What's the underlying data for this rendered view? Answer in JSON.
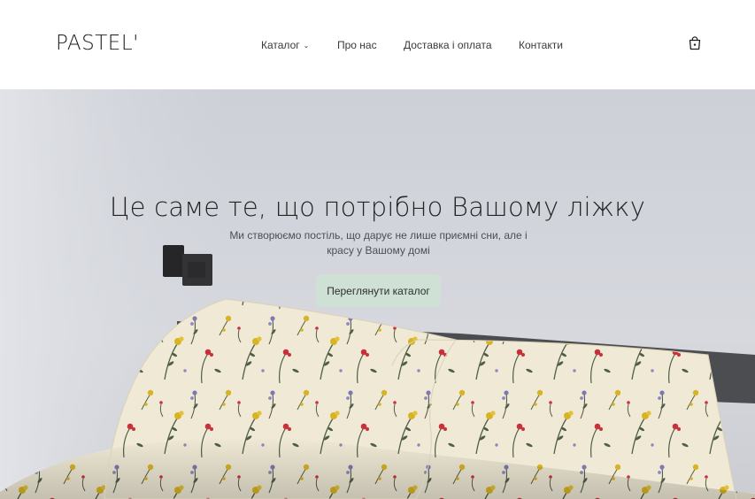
{
  "header": {
    "logo": "PASTEL'",
    "nav": [
      {
        "label": "Каталог",
        "has_dropdown": true
      },
      {
        "label": "Про нас"
      },
      {
        "label": "Доставка і оплата"
      },
      {
        "label": "Контакти"
      }
    ],
    "cart_icon": "shopping-bag-icon"
  },
  "hero": {
    "title": "Це саме те, що потрібно Вашому ліжку",
    "subtitle_line1": "Ми створюємо постіль, що дарує не лише приємні сни, але і",
    "subtitle_line2": "красу у Вашому домі",
    "cta_label": "Переглянути каталог"
  },
  "colors": {
    "accent_button": "#cfe0d4",
    "wall": "#d3d6dc",
    "bedding": "#efe9d6"
  }
}
